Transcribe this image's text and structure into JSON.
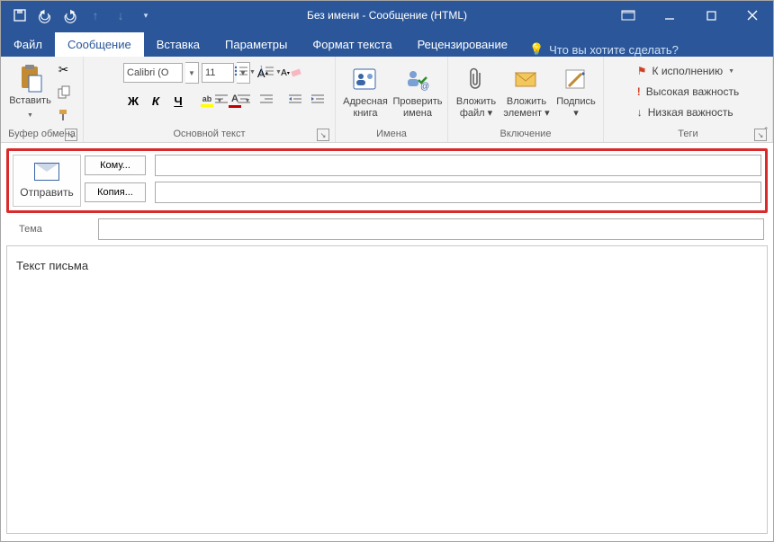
{
  "window": {
    "title": "Без имени - Сообщение (HTML)"
  },
  "tabs": [
    "Файл",
    "Сообщение",
    "Вставка",
    "Параметры",
    "Формат текста",
    "Рецензирование"
  ],
  "tellme": "Что вы хотите сделать?",
  "ribbon": {
    "clipboard": {
      "label": "Буфер обмена",
      "paste": "Вставить"
    },
    "text": {
      "label": "Основной текст",
      "font": "Calibri (О",
      "size": "11",
      "bold": "Ж",
      "italic": "К",
      "underline": "Ч"
    },
    "names": {
      "label": "Имена",
      "addressbook": "Адресная\nкнига",
      "checknames": "Проверить\nимена"
    },
    "include": {
      "label": "Включение",
      "attachfile": "Вложить\nфайл ▾",
      "attachitem": "Вложить\nэлемент ▾",
      "signature": "Подпись\n▾"
    },
    "tags": {
      "label": "Теги",
      "followup": "К исполнению",
      "high": "Высокая важность",
      "low": "Низкая важность"
    }
  },
  "compose": {
    "send": "Отправить",
    "to": "Кому...",
    "to_value": "",
    "cc": "Копия...",
    "cc_value": "",
    "subject_label": "Тема",
    "subject_value": "",
    "body": "Текст письма"
  }
}
